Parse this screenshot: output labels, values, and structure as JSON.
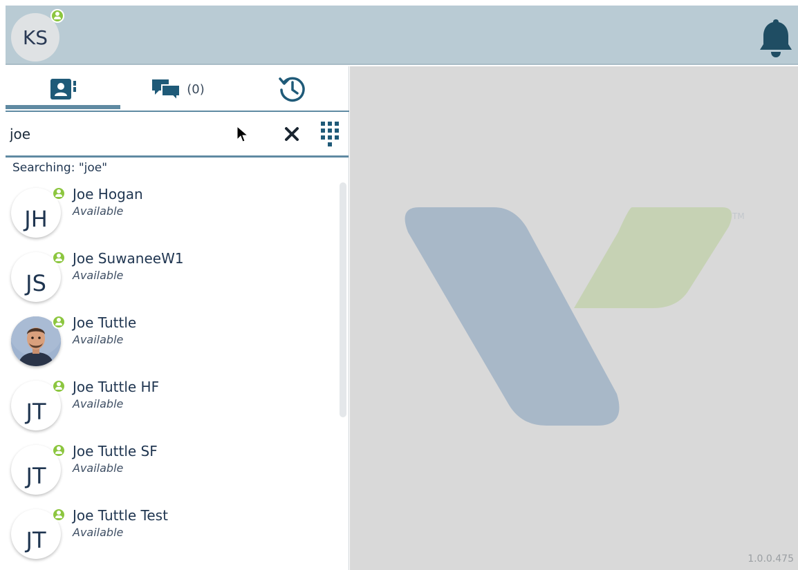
{
  "header": {
    "user_initials": "KS",
    "user_presence": "available",
    "notifications_icon": "bell-icon"
  },
  "tabs": [
    {
      "icon": "contacts-icon",
      "label": "",
      "active": true
    },
    {
      "icon": "chat-bubbles-icon",
      "label": "(0)",
      "active": false
    },
    {
      "icon": "history-icon",
      "label": "",
      "active": false
    }
  ],
  "search": {
    "value": "joe",
    "clear_icon": "close-icon",
    "dialpad_icon": "dialpad-icon"
  },
  "searching_text": "Searching: \"joe\"",
  "contacts": [
    {
      "initials": "JH",
      "name": "Joe Hogan",
      "status": "Available",
      "photo": false
    },
    {
      "initials": "JS",
      "name": "Joe SuwaneeW1",
      "status": "Available",
      "photo": false
    },
    {
      "initials": "",
      "name": "Joe Tuttle",
      "status": "Available",
      "photo": true
    },
    {
      "initials": "JT",
      "name": "Joe Tuttle HF",
      "status": "Available",
      "photo": false
    },
    {
      "initials": "JT",
      "name": "Joe Tuttle SF",
      "status": "Available",
      "photo": false
    },
    {
      "initials": "JT",
      "name": "Joe Tuttle Test",
      "status": "Available",
      "photo": false
    }
  ],
  "brand": {
    "trademark": "TM",
    "version": "1.0.0.475",
    "colors": {
      "blue": "#a8b8c8",
      "green": "#c6d2b4",
      "accent": "#5f8aa2",
      "presence": "#8cc63f"
    }
  }
}
